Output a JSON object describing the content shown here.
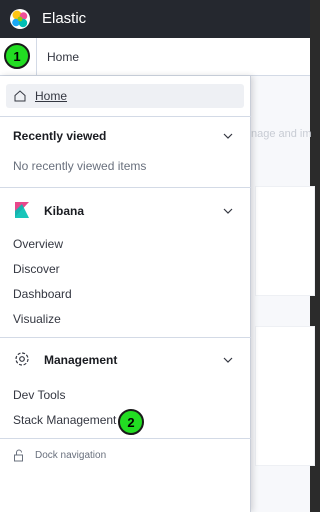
{
  "header": {
    "brand": "Elastic",
    "logo_icon": "elastic-logo"
  },
  "breadcrumb": {
    "home": "Home"
  },
  "background": {
    "hint_text": "nage and im"
  },
  "nav": {
    "home": {
      "label": "Home",
      "icon": "home-icon"
    },
    "recently_viewed": {
      "title": "Recently viewed",
      "empty_text": "No recently viewed items"
    },
    "kibana": {
      "title": "Kibana",
      "icon": "kibana-logo",
      "items": [
        "Overview",
        "Discover",
        "Dashboard",
        "Visualize"
      ]
    },
    "management": {
      "title": "Management",
      "icon": "gear-icon",
      "items": [
        "Dev Tools",
        "Stack Management"
      ]
    },
    "dock": {
      "label": "Dock navigation",
      "icon": "lock-open-icon"
    }
  },
  "markers": [
    "1",
    "2"
  ],
  "colors": {
    "header_bg": "#25282f",
    "marker": "#22dd22",
    "kibana_pink": "#e8478b",
    "kibana_teal": "#00bfb3"
  }
}
